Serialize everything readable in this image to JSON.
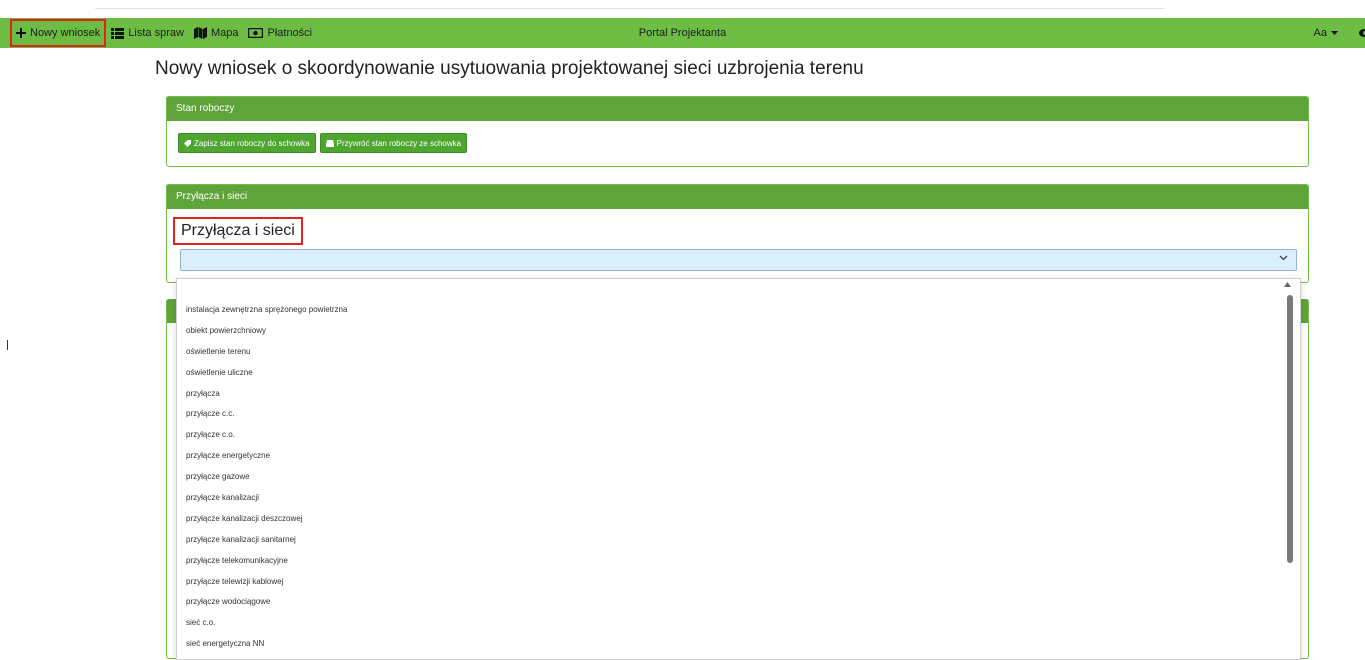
{
  "navbar": {
    "new_request": "Nowy wniosek",
    "case_list": "Lista spraw",
    "map": "Mapa",
    "payments": "Płatności",
    "app_title": "Portal Projektanta",
    "font_size": "Aa",
    "icons": {
      "new_request": "plus-icon",
      "case_list": "list-icon",
      "map": "map-icon",
      "payments": "money-icon",
      "font_size": "caret-down-icon",
      "extra": "eye-icon"
    }
  },
  "page": {
    "title": "Nowy wniosek o skoordynowanie usytuowania projektowanej sieci uzbrojenia terenu"
  },
  "draft_card": {
    "header": "Stan roboczy",
    "save_button": "Zapisz stan roboczy do schowka",
    "restore_button": "Przywróć stan roboczy ze schowka"
  },
  "connections_card": {
    "header": "Przyłącza i sieci",
    "label": "Przyłącza i sieci",
    "select_value": ""
  },
  "dropdown": {
    "options": [
      "instalacja zewnętrzna sprężonego powietrzna",
      "obiekt powierzchniowy",
      "oświetlenie terenu",
      "oświetlenie uliczne",
      "przyłącza",
      "przyłącze c.c.",
      "przyłącze c.o.",
      "przyłącze energetyczne",
      "przyłącze gazowe",
      "przyłącze kanalizacji",
      "przyłącze kanalizacji deszczowej",
      "przyłącze kanalizacji sanitarnej",
      "przyłącze telekomunikacyjne",
      "przyłącze telewizji kablowej",
      "przyłącze wodociągowe",
      "sieć c.o.",
      "sieć energetyczna NN"
    ]
  },
  "colors": {
    "navbar": "#6dbd45",
    "card_header": "#5fa43a",
    "button": "#4ea52f",
    "highlight": "#e52020",
    "select_bg": "#dbeefc"
  }
}
